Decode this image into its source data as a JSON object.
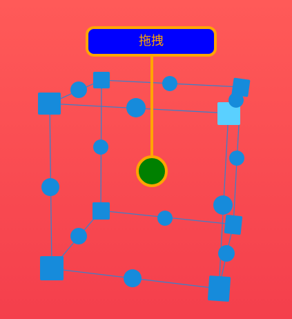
{
  "scene": {
    "background_color": "#f7474f",
    "box_color": "#168bdb",
    "selected_corner_color": "#5ad0ff",
    "leader_line_color": "#ffa500"
  },
  "drag_control": {
    "label": "拖拽",
    "fill_color": "#0000ff",
    "border_color": "#ffa500",
    "text_color": "#ffa500"
  },
  "drag_handle": {
    "fill_color": "#008000",
    "ring_color": "#ffa500"
  }
}
